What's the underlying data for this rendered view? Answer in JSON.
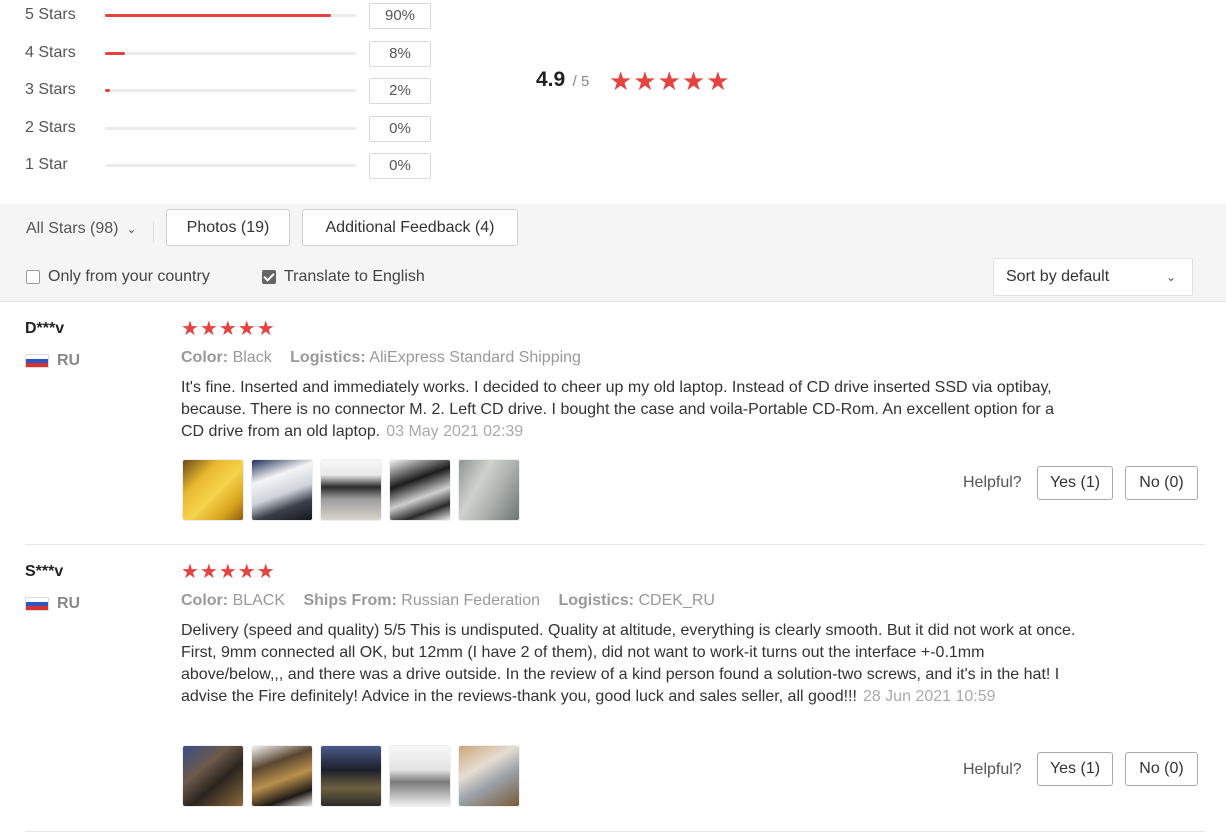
{
  "rating_summary": {
    "distribution": [
      {
        "label": "5 Stars",
        "percent_text": "90%",
        "fraction": 0.9
      },
      {
        "label": "4 Stars",
        "percent_text": "8%",
        "fraction": 0.08
      },
      {
        "label": "3 Stars",
        "percent_text": "2%",
        "fraction": 0.02
      },
      {
        "label": "2 Stars",
        "percent_text": "0%",
        "fraction": 0.0
      },
      {
        "label": "1 Star",
        "percent_text": "0%",
        "fraction": 0.0
      }
    ],
    "average": "4.9",
    "out_of": "/ 5",
    "stars": "★★★★★",
    "bar_color": "#e64340"
  },
  "filters": {
    "all_stars": "All Stars (98)",
    "photos": "Photos (19)",
    "additional_feedback": "Additional Feedback (4)",
    "only_country": {
      "label": "Only from your country",
      "checked": false
    },
    "translate": {
      "label": "Translate to English",
      "checked": true
    },
    "sort": "Sort by default"
  },
  "reviews": [
    {
      "user": "D***v",
      "country": "RU",
      "stars": "★★★★★",
      "meta": [
        {
          "key": "Color:",
          "value": "Black"
        },
        {
          "key": "Logistics:",
          "value": "AliExpress Standard Shipping"
        }
      ],
      "text": "It's fine. Inserted and immediately works. I decided to cheer up my old laptop. Instead of CD drive inserted SSD via optibay, because. There is no connector M. 2. Left CD drive. I bought the case and voila-Portable CD-Rom. An excellent option for a CD drive from an old laptop.",
      "date": "03 May 2021 02:39",
      "photo_count": 5,
      "helpful_label": "Helpful?",
      "yes": "Yes (1)",
      "no": "No (0)"
    },
    {
      "user": "S***v",
      "country": "RU",
      "stars": "★★★★★",
      "meta": [
        {
          "key": "Color:",
          "value": "BLACK"
        },
        {
          "key": "Ships From:",
          "value": "Russian Federation"
        },
        {
          "key": "Logistics:",
          "value": "CDEK_RU"
        }
      ],
      "text": "Delivery (speed and quality) 5/5 This is undisputed. Quality at altitude, everything is clearly smooth. But it did not work at once. First, 9mm connected all OK, but 12mm (I have 2 of them), did not want to work-it turns out the interface +-0.1mm above/below,,, and there was a drive outside. In the review of a kind person found a solution-two screws, and it's in the hat! I advise the Fire definitely! Advice in the reviews-thank you, good luck and sales seller, all good!!!",
      "date": "28 Jun 2021 10:59",
      "photo_count": 5,
      "helpful_label": "Helpful?",
      "yes": "Yes (1)",
      "no": "No (0)"
    }
  ]
}
